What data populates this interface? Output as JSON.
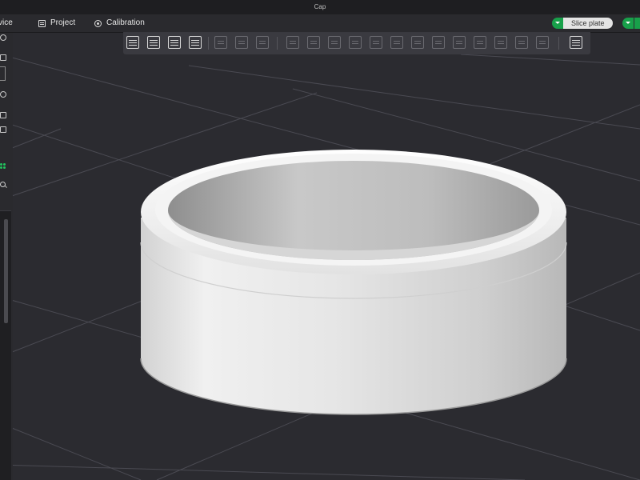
{
  "window": {
    "title": "Cap"
  },
  "menu": {
    "device_partial": "vice",
    "project": "Project",
    "calibration": "Calibration"
  },
  "actions": {
    "slice_plate": "Slice plate"
  },
  "toolbar": {
    "icons": [
      "add-object-icon",
      "add-plate-icon",
      "auto-orient-icon",
      "arrange-icon",
      "copy-icon",
      "paste-icon",
      "layers-icon",
      "move-icon",
      "rotate-icon",
      "scale-icon",
      "lay-on-face-icon",
      "cut-icon",
      "support-paint-icon",
      "seam-paint-icon",
      "text-icon",
      "measure-icon",
      "assembly-icon",
      "split-icon",
      "variable-layer-icon"
    ]
  },
  "colors": {
    "accent_green": "#18a04a",
    "background": "#2b2b30",
    "model": "#e0e0e0"
  }
}
